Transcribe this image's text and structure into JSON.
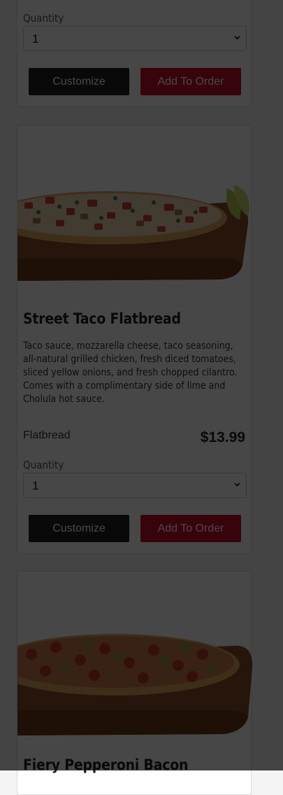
{
  "previous_item": {
    "quantity_label": "Quantity",
    "quantity_value": "1",
    "customize_label": "Customize",
    "add_label": "Add To Order"
  },
  "items": [
    {
      "title": "Street Taco Flatbread",
      "description": "Taco sauce, mozzarella cheese, taco seasoning, all-natural grilled chicken, fresh diced tomatoes, sliced yellow onions, and fresh chopped cilantro. Comes with a complimentary side of lime and Cholula hot sauce.",
      "size": "Flatbread",
      "price": "$13.99",
      "quantity_label": "Quantity",
      "quantity_value": "1",
      "customize_label": "Customize",
      "add_label": "Add To Order"
    },
    {
      "title": "Fiery Pepperoni Bacon"
    }
  ],
  "colors": {
    "overlay": "rgba(0,0,0,0.72)",
    "add_button": "#c8102e",
    "customize_button": "#222222"
  }
}
